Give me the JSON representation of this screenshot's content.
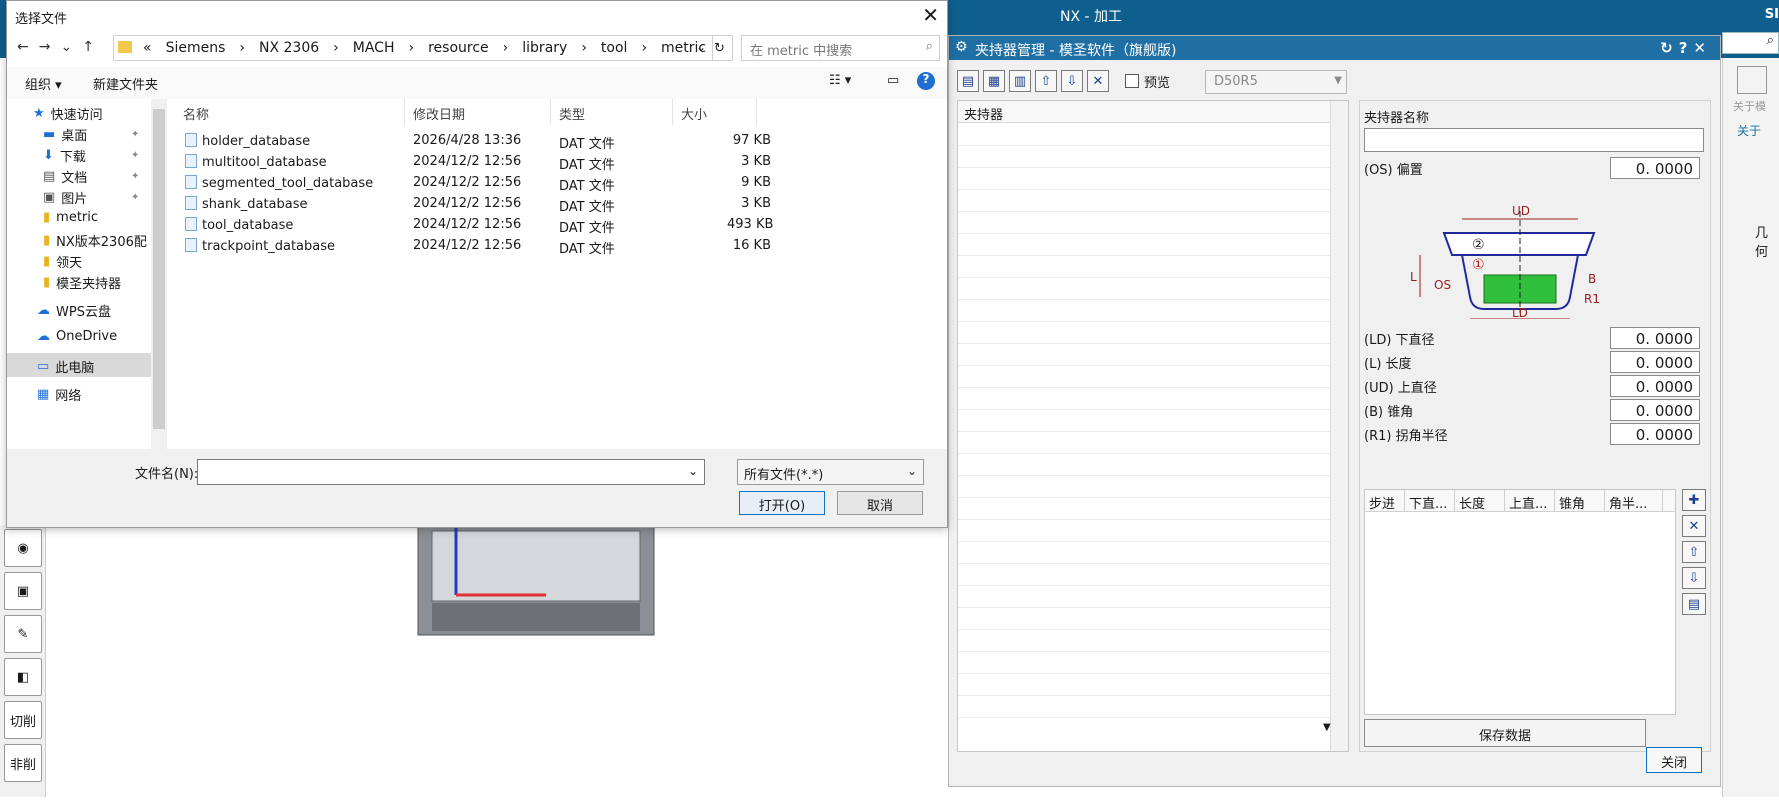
{
  "nx": {
    "title": "NX - 加工",
    "brand": "SI",
    "right_panel": {
      "about_label": "关于模",
      "about_tab": "关于",
      "col_label": "几何"
    },
    "tools": [
      {
        "label": "切削"
      },
      {
        "label": "非削"
      }
    ]
  },
  "holder_dialog": {
    "title": "夹持器管理 - 模圣软件（旗舰版)",
    "preview_label": "预览",
    "holder_combo_value": "D50R5",
    "holder_list_header": "夹持器",
    "name_label": "夹持器名称",
    "name_value": "",
    "fields": [
      {
        "label": "(OS) 偏置",
        "value": "0. 0000"
      },
      {
        "label": "(LD) 下直径",
        "value": "0. 0000"
      },
      {
        "label": "(L) 长度",
        "value": "0. 0000"
      },
      {
        "label": "(UD) 上直径",
        "value": "0. 0000"
      },
      {
        "label": "(B) 锥角",
        "value": "0. 0000"
      },
      {
        "label": "(R1) 拐角半径",
        "value": "0. 0000"
      }
    ],
    "diagram": {
      "ud": "UD",
      "ld": "LD",
      "l": "L",
      "os": "OS",
      "b": "B",
      "r1": "R1",
      "n1": "①",
      "n2": "②"
    },
    "step_columns": [
      "步进",
      "下直...",
      "长度",
      "上直...",
      "锥角",
      "角半..."
    ],
    "save_label": "保存数据",
    "close_label": "关闭"
  },
  "file_dialog": {
    "title": "选择文件",
    "breadcrumbs": [
      "«",
      "Siemens",
      "›",
      "NX 2306",
      "›",
      "MACH",
      "›",
      "resource",
      "›",
      "library",
      "›",
      "tool",
      "›",
      "metric"
    ],
    "search_placeholder": "在 metric 中搜索",
    "organize_label": "组织 ▾",
    "new_folder_label": "新建文件夹",
    "nav_items": [
      {
        "label": "快速访问",
        "icon": "star-icon"
      },
      {
        "label": "桌面",
        "icon": "desktop-icon"
      },
      {
        "label": "下载",
        "icon": "download-icon"
      },
      {
        "label": "文档",
        "icon": "document-icon"
      },
      {
        "label": "图片",
        "icon": "picture-icon"
      },
      {
        "label": "metric",
        "icon": "folder-icon"
      },
      {
        "label": "NX版本2306配",
        "icon": "folder-icon"
      },
      {
        "label": "领天",
        "icon": "folder-icon"
      },
      {
        "label": "模圣夹持器",
        "icon": "folder-icon"
      },
      {
        "label": "WPS云盘",
        "icon": "cloud-icon"
      },
      {
        "label": "OneDrive",
        "icon": "cloud-icon"
      },
      {
        "label": "此电脑",
        "icon": "computer-icon"
      },
      {
        "label": "网络",
        "icon": "network-icon"
      }
    ],
    "columns": {
      "name": "名称",
      "date": "修改日期",
      "type": "类型",
      "size": "大小"
    },
    "files": [
      {
        "name": "holder_database",
        "date": "2026/4/28 13:36",
        "type": "DAT 文件",
        "size": "97 KB"
      },
      {
        "name": "multitool_database",
        "date": "2024/12/2 12:56",
        "type": "DAT 文件",
        "size": "3 KB"
      },
      {
        "name": "segmented_tool_database",
        "date": "2024/12/2 12:56",
        "type": "DAT 文件",
        "size": "9 KB"
      },
      {
        "name": "shank_database",
        "date": "2024/12/2 12:56",
        "type": "DAT 文件",
        "size": "3 KB"
      },
      {
        "name": "tool_database",
        "date": "2024/12/2 12:56",
        "type": "DAT 文件",
        "size": "493 KB"
      },
      {
        "name": "trackpoint_database",
        "date": "2024/12/2 12:56",
        "type": "DAT 文件",
        "size": "16 KB"
      }
    ],
    "filename_label": "文件名(N):",
    "filename_value": "",
    "filetype_value": "所有文件(*.*)",
    "open_label": "打开(O)",
    "cancel_label": "取消"
  }
}
